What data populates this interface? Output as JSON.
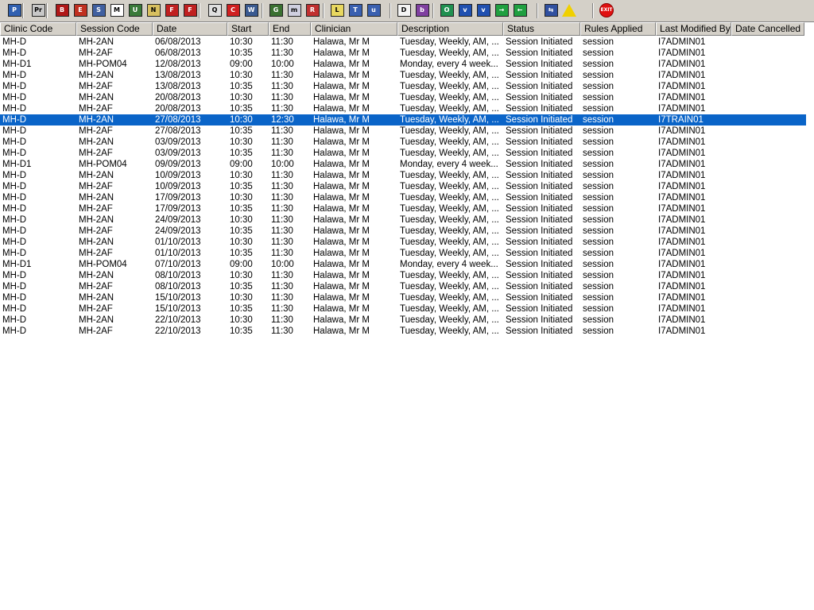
{
  "toolbar": {
    "buttons": [
      {
        "icon": "patient-icon",
        "glyph": "P"
      },
      {
        "icon": "print-icon",
        "glyph": "Pr"
      },
      {
        "icon": "book-icon",
        "glyph": "B"
      },
      {
        "icon": "edit-book-icon",
        "glyph": "E"
      },
      {
        "icon": "screen-icon",
        "glyph": "S"
      },
      {
        "icon": "mail-icon",
        "glyph": "M"
      },
      {
        "icon": "person-icon",
        "glyph": "U"
      },
      {
        "icon": "note-icon",
        "glyph": "N"
      },
      {
        "icon": "flag-icon",
        "glyph": "F"
      },
      {
        "icon": "flag-icon",
        "glyph": "F"
      },
      {
        "icon": "search-icon",
        "glyph": "Q"
      },
      {
        "icon": "clock-icon",
        "glyph": "C"
      },
      {
        "icon": "window-icon",
        "glyph": "W"
      },
      {
        "icon": "chart-icon",
        "glyph": "G"
      },
      {
        "icon": "message-icon",
        "glyph": "m"
      },
      {
        "icon": "refresh-icon",
        "glyph": "R"
      },
      {
        "icon": "list-icon",
        "glyph": "L"
      },
      {
        "icon": "transfer-icon",
        "glyph": "T"
      },
      {
        "icon": "user-edit-icon",
        "glyph": "u"
      },
      {
        "icon": "document-icon",
        "glyph": "D"
      },
      {
        "icon": "bar-chart-icon",
        "glyph": "b"
      },
      {
        "icon": "globe-icon",
        "glyph": "O"
      },
      {
        "icon": "check-window-icon",
        "glyph": "v"
      },
      {
        "icon": "check-window-icon",
        "glyph": "v"
      },
      {
        "icon": "forward-icon",
        "glyph": "→"
      },
      {
        "icon": "back-icon",
        "glyph": "←"
      },
      {
        "icon": "swap-icon",
        "glyph": "⇆"
      },
      {
        "icon": "warning-icon",
        "glyph": "!"
      },
      {
        "icon": "exit-icon",
        "glyph": "EXIT"
      }
    ]
  },
  "columns": [
    "Clinic Code",
    "Session Code",
    "Date",
    "Start",
    "End",
    "Clinician",
    "Description",
    "Status",
    "Rules Applied",
    "Last Modified By",
    "Date Cancelled"
  ],
  "rows": [
    [
      "MH-D",
      "MH-2AN",
      "06/08/2013",
      "10:30",
      "11:30",
      "Halawa, Mr M",
      "Tuesday, Weekly, AM, ...",
      "Session Initiated",
      "session",
      "I7ADMIN01",
      ""
    ],
    [
      "MH-D",
      "MH-2AF",
      "06/08/2013",
      "10:35",
      "11:30",
      "Halawa, Mr M",
      "Tuesday, Weekly, AM, ...",
      "Session Initiated",
      "session",
      "I7ADMIN01",
      ""
    ],
    [
      "MH-D1",
      "MH-POM04",
      "12/08/2013",
      "09:00",
      "10:00",
      "Halawa, Mr M",
      "Monday, every 4 week...",
      "Session Initiated",
      "session",
      "I7ADMIN01",
      ""
    ],
    [
      "MH-D",
      "MH-2AN",
      "13/08/2013",
      "10:30",
      "11:30",
      "Halawa, Mr M",
      "Tuesday, Weekly, AM, ...",
      "Session Initiated",
      "session",
      "I7ADMIN01",
      ""
    ],
    [
      "MH-D",
      "MH-2AF",
      "13/08/2013",
      "10:35",
      "11:30",
      "Halawa, Mr M",
      "Tuesday, Weekly, AM, ...",
      "Session Initiated",
      "session",
      "I7ADMIN01",
      ""
    ],
    [
      "MH-D",
      "MH-2AN",
      "20/08/2013",
      "10:30",
      "11:30",
      "Halawa, Mr M",
      "Tuesday, Weekly, AM, ...",
      "Session Initiated",
      "session",
      "I7ADMIN01",
      ""
    ],
    [
      "MH-D",
      "MH-2AF",
      "20/08/2013",
      "10:35",
      "11:30",
      "Halawa, Mr M",
      "Tuesday, Weekly, AM, ...",
      "Session Initiated",
      "session",
      "I7ADMIN01",
      ""
    ],
    [
      "MH-D",
      "MH-2AN",
      "27/08/2013",
      "10:30",
      "12:30",
      "Halawa, Mr M",
      "Tuesday, Weekly, AM, ...",
      "Session Initiated",
      "session",
      "I7TRAIN01",
      ""
    ],
    [
      "MH-D",
      "MH-2AF",
      "27/08/2013",
      "10:35",
      "11:30",
      "Halawa, Mr M",
      "Tuesday, Weekly, AM, ...",
      "Session Initiated",
      "session",
      "I7ADMIN01",
      ""
    ],
    [
      "MH-D",
      "MH-2AN",
      "03/09/2013",
      "10:30",
      "11:30",
      "Halawa, Mr M",
      "Tuesday, Weekly, AM, ...",
      "Session Initiated",
      "session",
      "I7ADMIN01",
      ""
    ],
    [
      "MH-D",
      "MH-2AF",
      "03/09/2013",
      "10:35",
      "11:30",
      "Halawa, Mr M",
      "Tuesday, Weekly, AM, ...",
      "Session Initiated",
      "session",
      "I7ADMIN01",
      ""
    ],
    [
      "MH-D1",
      "MH-POM04",
      "09/09/2013",
      "09:00",
      "10:00",
      "Halawa, Mr M",
      "Monday, every 4 week...",
      "Session Initiated",
      "session",
      "I7ADMIN01",
      ""
    ],
    [
      "MH-D",
      "MH-2AN",
      "10/09/2013",
      "10:30",
      "11:30",
      "Halawa, Mr M",
      "Tuesday, Weekly, AM, ...",
      "Session Initiated",
      "session",
      "I7ADMIN01",
      ""
    ],
    [
      "MH-D",
      "MH-2AF",
      "10/09/2013",
      "10:35",
      "11:30",
      "Halawa, Mr M",
      "Tuesday, Weekly, AM, ...",
      "Session Initiated",
      "session",
      "I7ADMIN01",
      ""
    ],
    [
      "MH-D",
      "MH-2AN",
      "17/09/2013",
      "10:30",
      "11:30",
      "Halawa, Mr M",
      "Tuesday, Weekly, AM, ...",
      "Session Initiated",
      "session",
      "I7ADMIN01",
      ""
    ],
    [
      "MH-D",
      "MH-2AF",
      "17/09/2013",
      "10:35",
      "11:30",
      "Halawa, Mr M",
      "Tuesday, Weekly, AM, ...",
      "Session Initiated",
      "session",
      "I7ADMIN01",
      ""
    ],
    [
      "MH-D",
      "MH-2AN",
      "24/09/2013",
      "10:30",
      "11:30",
      "Halawa, Mr M",
      "Tuesday, Weekly, AM, ...",
      "Session Initiated",
      "session",
      "I7ADMIN01",
      ""
    ],
    [
      "MH-D",
      "MH-2AF",
      "24/09/2013",
      "10:35",
      "11:30",
      "Halawa, Mr M",
      "Tuesday, Weekly, AM, ...",
      "Session Initiated",
      "session",
      "I7ADMIN01",
      ""
    ],
    [
      "MH-D",
      "MH-2AN",
      "01/10/2013",
      "10:30",
      "11:30",
      "Halawa, Mr M",
      "Tuesday, Weekly, AM, ...",
      "Session Initiated",
      "session",
      "I7ADMIN01",
      ""
    ],
    [
      "MH-D",
      "MH-2AF",
      "01/10/2013",
      "10:35",
      "11:30",
      "Halawa, Mr M",
      "Tuesday, Weekly, AM, ...",
      "Session Initiated",
      "session",
      "I7ADMIN01",
      ""
    ],
    [
      "MH-D1",
      "MH-POM04",
      "07/10/2013",
      "09:00",
      "10:00",
      "Halawa, Mr M",
      "Monday, every 4 week...",
      "Session Initiated",
      "session",
      "I7ADMIN01",
      ""
    ],
    [
      "MH-D",
      "MH-2AN",
      "08/10/2013",
      "10:30",
      "11:30",
      "Halawa, Mr M",
      "Tuesday, Weekly, AM, ...",
      "Session Initiated",
      "session",
      "I7ADMIN01",
      ""
    ],
    [
      "MH-D",
      "MH-2AF",
      "08/10/2013",
      "10:35",
      "11:30",
      "Halawa, Mr M",
      "Tuesday, Weekly, AM, ...",
      "Session Initiated",
      "session",
      "I7ADMIN01",
      ""
    ],
    [
      "MH-D",
      "MH-2AN",
      "15/10/2013",
      "10:30",
      "11:30",
      "Halawa, Mr M",
      "Tuesday, Weekly, AM, ...",
      "Session Initiated",
      "session",
      "I7ADMIN01",
      ""
    ],
    [
      "MH-D",
      "MH-2AF",
      "15/10/2013",
      "10:35",
      "11:30",
      "Halawa, Mr M",
      "Tuesday, Weekly, AM, ...",
      "Session Initiated",
      "session",
      "I7ADMIN01",
      ""
    ],
    [
      "MH-D",
      "MH-2AN",
      "22/10/2013",
      "10:30",
      "11:30",
      "Halawa, Mr M",
      "Tuesday, Weekly, AM, ...",
      "Session Initiated",
      "session",
      "I7ADMIN01",
      ""
    ],
    [
      "MH-D",
      "MH-2AF",
      "22/10/2013",
      "10:35",
      "11:30",
      "Halawa, Mr M",
      "Tuesday, Weekly, AM, ...",
      "Session Initiated",
      "session",
      "I7ADMIN01",
      ""
    ]
  ],
  "selected_row": 7,
  "colors": {
    "selection": "#0a64c8",
    "toolbar_bg": "#d4d0c8"
  }
}
